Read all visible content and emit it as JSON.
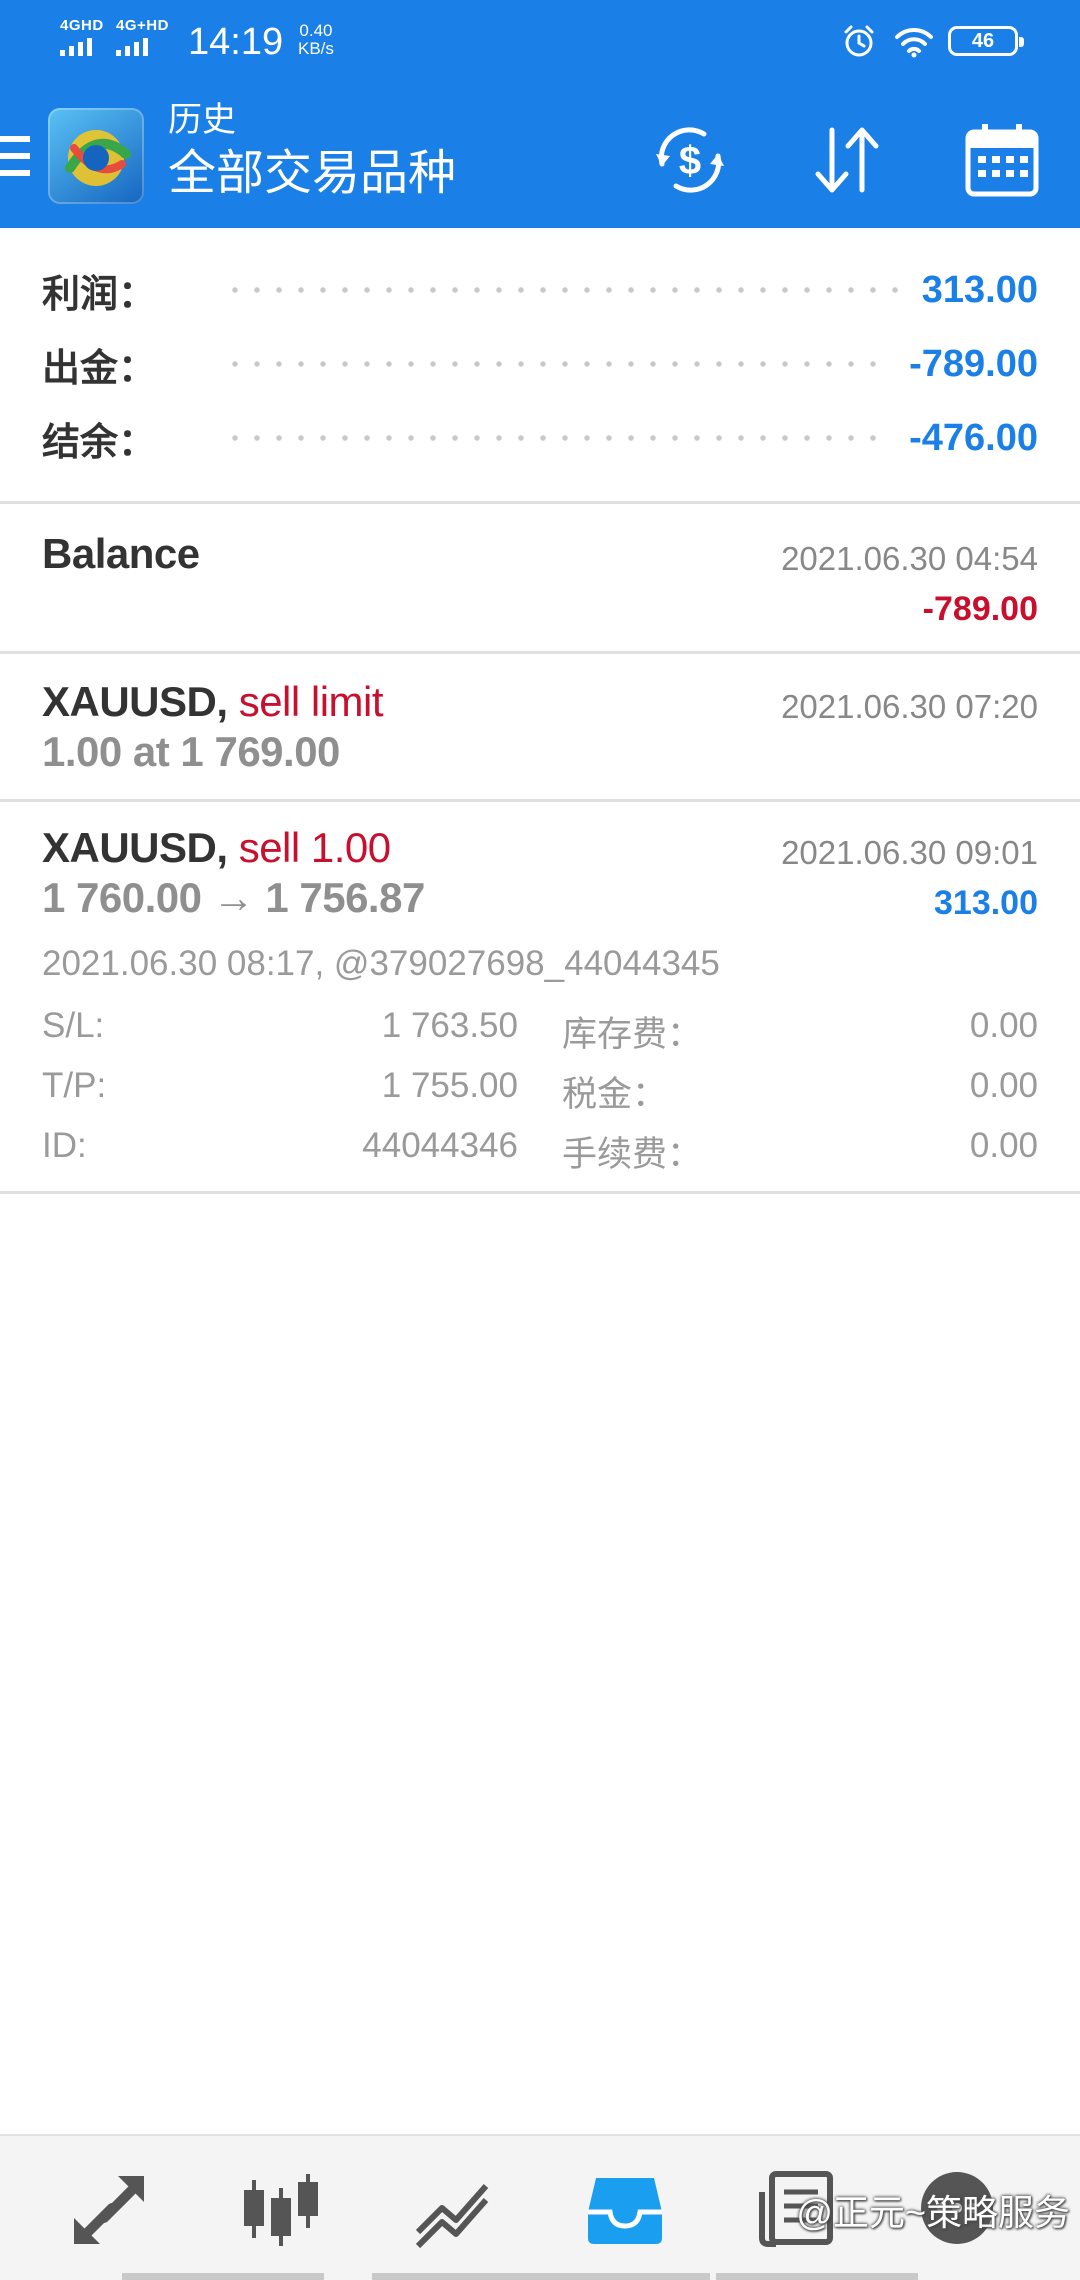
{
  "status_bar": {
    "sim1": "4GHD",
    "sim2": "4G+HD",
    "time": "14:19",
    "speed_value": "0.40",
    "speed_unit": "KB/s",
    "battery": "46"
  },
  "header": {
    "subtitle": "历史",
    "title": "全部交易品种",
    "icons": [
      "menu-icon",
      "metatrader-logo",
      "dollar-refresh-icon",
      "sort-icon",
      "calendar-icon"
    ]
  },
  "summary": [
    {
      "label": "利润：",
      "value": "313.00"
    },
    {
      "label": "出金：",
      "value": "-789.00"
    },
    {
      "label": "结余：",
      "value": "-476.00"
    }
  ],
  "deals": {
    "balance": {
      "name": "Balance",
      "datetime": "2021.06.30 04:54",
      "amount": "-789.00"
    },
    "order": {
      "symbol": "XAUUSD,",
      "type": "sell limit",
      "datetime": "2021.06.30 07:20",
      "detail": "1.00 at 1 769.00"
    },
    "position": {
      "symbol": "XAUUSD,",
      "type": "sell 1.00",
      "datetime": "2021.06.30 09:01",
      "prices": "1 760.00 → 1 756.87",
      "profit": "313.00",
      "meta": "2021.06.30 08:17, @379027698_44044345",
      "details": [
        {
          "k1": "S/L:",
          "v1": "1 763.50",
          "k2": "库存费：",
          "v2": "0.00"
        },
        {
          "k1": "T/P:",
          "v1": "1 755.00",
          "k2": "税金：",
          "v2": "0.00"
        },
        {
          "k1": "ID:",
          "v1": "44044346",
          "k2": "手续费：",
          "v2": "0.00"
        }
      ]
    }
  },
  "bottom_nav": {
    "icons": [
      "trade-arrows-icon",
      "candlestick-icon",
      "chart-lines-icon",
      "inbox-icon",
      "news-icon",
      "chat-icon"
    ],
    "active": "inbox-icon",
    "watermark": "@正元~策略服务"
  },
  "colors": {
    "accent": "#1a7fe6",
    "negative": "#c8102e",
    "text": "#333333",
    "muted": "#9a9a9a"
  }
}
